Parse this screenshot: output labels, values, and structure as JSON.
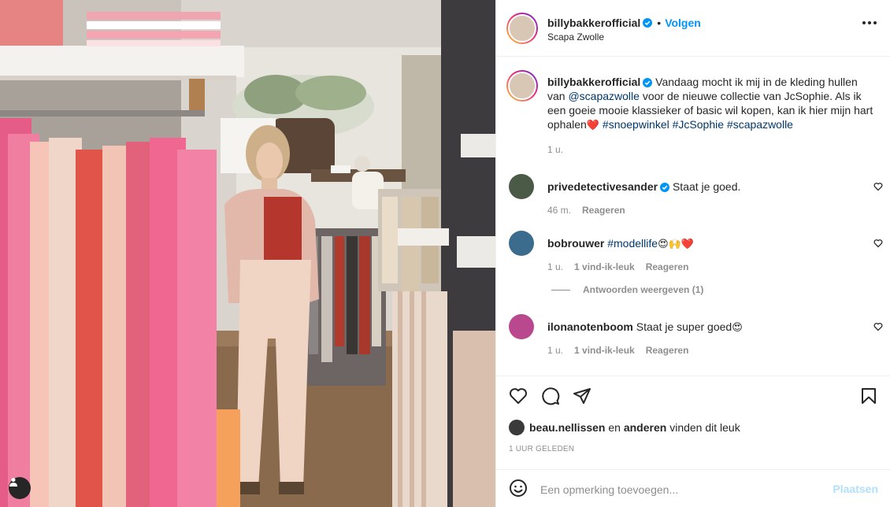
{
  "post": {
    "author": "billybakkerofficial",
    "location": "Scapa Zwolle",
    "follow_label": "Volgen",
    "bullet": "•"
  },
  "caption": {
    "username": "billybakkerofficial",
    "text_1": "Vandaag mocht ik mij in de kleding hullen van ",
    "mention": "@scapazwolle",
    "text_2": " voor de nieuwe collectie van JcSophie. Als ik een goeie mooie klassieker of basic wil kopen, kan ik hier mijn hart ophalen",
    "heart": "❤️",
    "tag_1": "#snoepwinkel",
    "tag_2": "#JcSophie",
    "tag_3": "#scapazwolle",
    "time": "1 u."
  },
  "comments": [
    {
      "username": "privedetectivesander",
      "verified": true,
      "text": "Staat je goed.",
      "time": "46 m.",
      "likes": "",
      "reply": "Reageren"
    },
    {
      "username": "bobrouwer",
      "verified": false,
      "hashtag": "#modellife",
      "emojis": "😍🙌❤️",
      "time": "1 u.",
      "likes": "1 vind-ik-leuk",
      "reply": "Reageren"
    },
    {
      "username": "ilonanotenboom",
      "verified": false,
      "text": "Staat je super goed",
      "emojis": "😍",
      "time": "1 u.",
      "likes": "1 vind-ik-leuk",
      "reply": "Reageren"
    }
  ],
  "view_replies": "Antwoorden weergeven (1)",
  "likes_line": {
    "user": "beau.nellissen",
    "middle": " en ",
    "others": "anderen",
    "suffix": " vinden dit leuk"
  },
  "timestamp": "1 UUR GELEDEN",
  "add_comment": {
    "placeholder": "Een opmerking toevoegen...",
    "post_label": "Plaatsen"
  },
  "icons": {
    "verified": "verified-badge-icon",
    "more": "more-options-icon",
    "like": "heart-icon",
    "comment": "comment-bubble-icon",
    "share": "paper-plane-icon",
    "save": "bookmark-icon",
    "emoji": "smiley-icon",
    "tag": "user-tag-icon"
  },
  "colors": {
    "accent": "#0095f6",
    "link": "#00376b",
    "muted": "#8e8e8e",
    "post_disabled": "#b2dffc"
  }
}
